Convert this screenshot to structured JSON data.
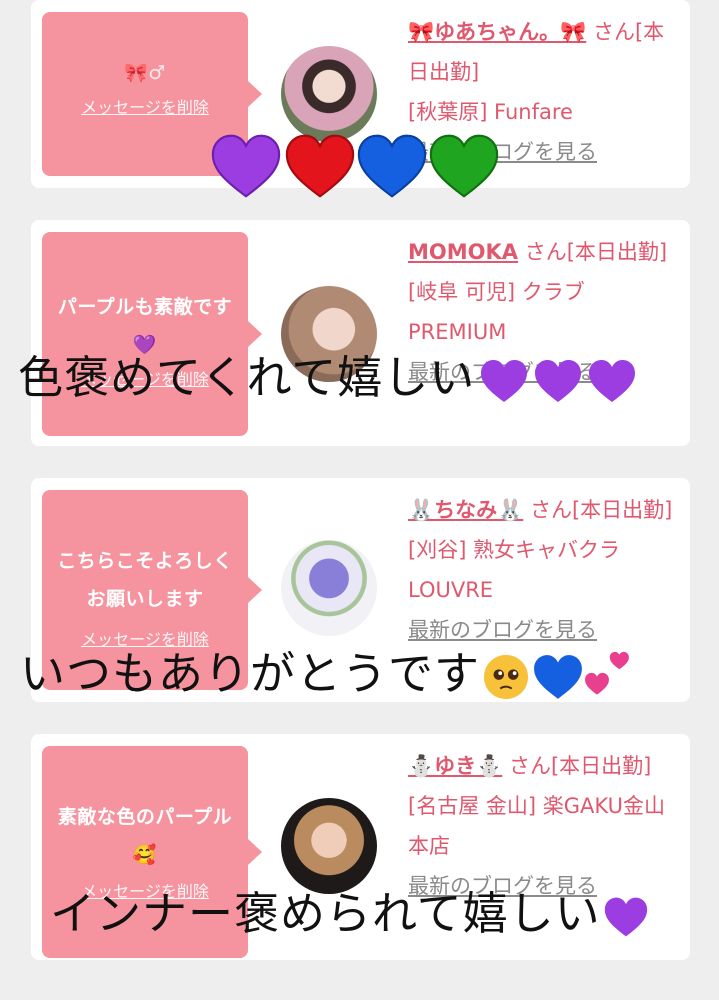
{
  "cards": [
    {
      "message": "🎀♂︎",
      "delete_label": "メッセージを削除",
      "name": "🎀ゆあちゃん。🎀",
      "suffix": "さん[本日出勤]",
      "shop": "[秋葉原] Funfare",
      "blog_label": "最新のブログを見る"
    },
    {
      "message": "パープルも素敵です💜",
      "delete_label": "メッセージを削除",
      "name": "MOMOKA",
      "suffix": "さん[本日出勤]",
      "shop": "[岐阜 可児] クラブ PREMIUM",
      "blog_label": "最新のブログを見る"
    },
    {
      "message": "こちらこそよろしくお願いします",
      "delete_label": "メッセージを削除",
      "name": "🐰ちなみ🐰",
      "suffix": "さん[本日出勤]",
      "shop": "[刈谷] 熟女キャバクラ LOUVRE",
      "blog_label": "最新のブログを見る"
    },
    {
      "message": "素敵な色のパープル🥰",
      "delete_label": "メッセージを削除",
      "name": "⛄ゆき⛄",
      "suffix": "さん[本日出勤]",
      "shop": "[名古屋 金山] 楽GAKU金山本店",
      "blog_label": "最新のブログを見る"
    }
  ],
  "overlays": {
    "line1": "色褒めてくれて嬉しい",
    "line2": "いつもありがとうです",
    "line3": "インナー褒められて嬉しい"
  },
  "hearts_row": [
    "purple-heart",
    "red-heart",
    "blue-heart",
    "green-heart"
  ],
  "colors": {
    "bubble": "#f5949f",
    "name": "#e0586e",
    "purple": "#9b3de0",
    "red": "#e3141b",
    "blue": "#1560e0",
    "green": "#1fa51f"
  }
}
